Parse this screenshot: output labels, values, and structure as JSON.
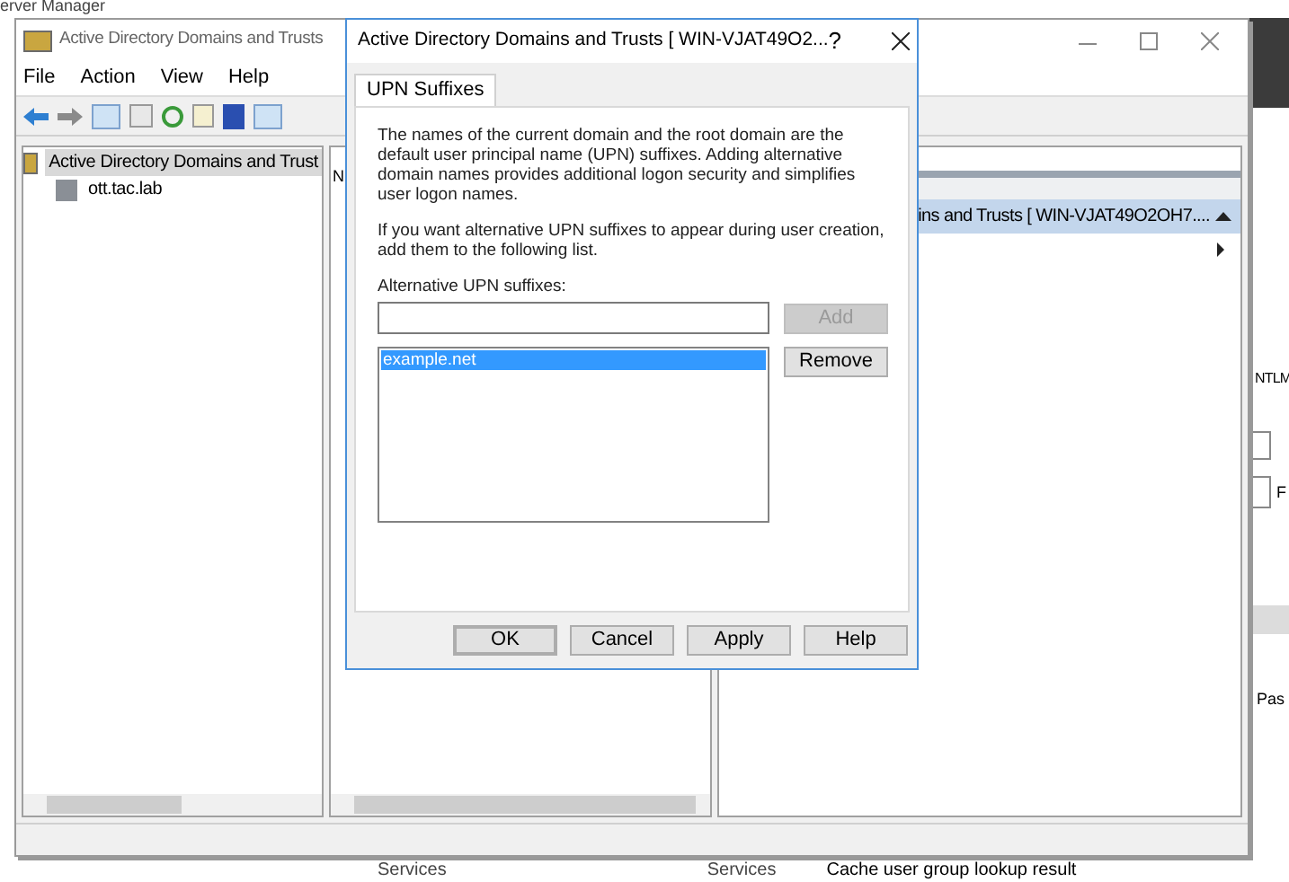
{
  "background": {
    "title": "erver Manager",
    "fragments": [
      {
        "text": "NTLM"
      },
      {
        "text": "F"
      },
      {
        "text": "Pas"
      }
    ],
    "bottom_row": [
      "Services",
      "Services",
      "Cache user group lookup result"
    ]
  },
  "main_window": {
    "title": "Active Directory Domains and Trusts",
    "menu": [
      "File",
      "Action",
      "View",
      "Help"
    ],
    "tree": [
      {
        "label": "Active Directory Domains and Trust",
        "selected": true,
        "children": [
          {
            "label": "ott.tac.lab",
            "selected": false
          }
        ]
      }
    ],
    "middle_header": "N",
    "actions": {
      "header": "ins and Trusts [ WIN-VJAT49O2OH7....",
      "expanded": true
    }
  },
  "dialog": {
    "title": "Active Directory Domains and Trusts [ WIN-VJAT49O2...",
    "help_glyph": "?",
    "tabs": [
      {
        "label": "UPN Suffixes",
        "selected": true
      }
    ],
    "paragraphs": [
      "The names of the current domain and the root domain are the default user principal name (UPN) suffixes. Adding alternative domain names provides additional logon security and simplifies user logon names.",
      "If you want alternative UPN suffixes to appear during user creation, add them to the following list."
    ],
    "field_label": "Alternative UPN suffixes:",
    "add_button": {
      "label": "Add",
      "disabled": true
    },
    "suffixes": [
      {
        "label": "example.net",
        "selected": true
      }
    ],
    "remove_button": {
      "label": "Remove",
      "disabled": false
    },
    "buttons": [
      {
        "label": "OK",
        "default": true
      },
      {
        "label": "Cancel",
        "default": false
      },
      {
        "label": "Apply",
        "default": false
      },
      {
        "label": "Help",
        "default": false
      }
    ]
  }
}
